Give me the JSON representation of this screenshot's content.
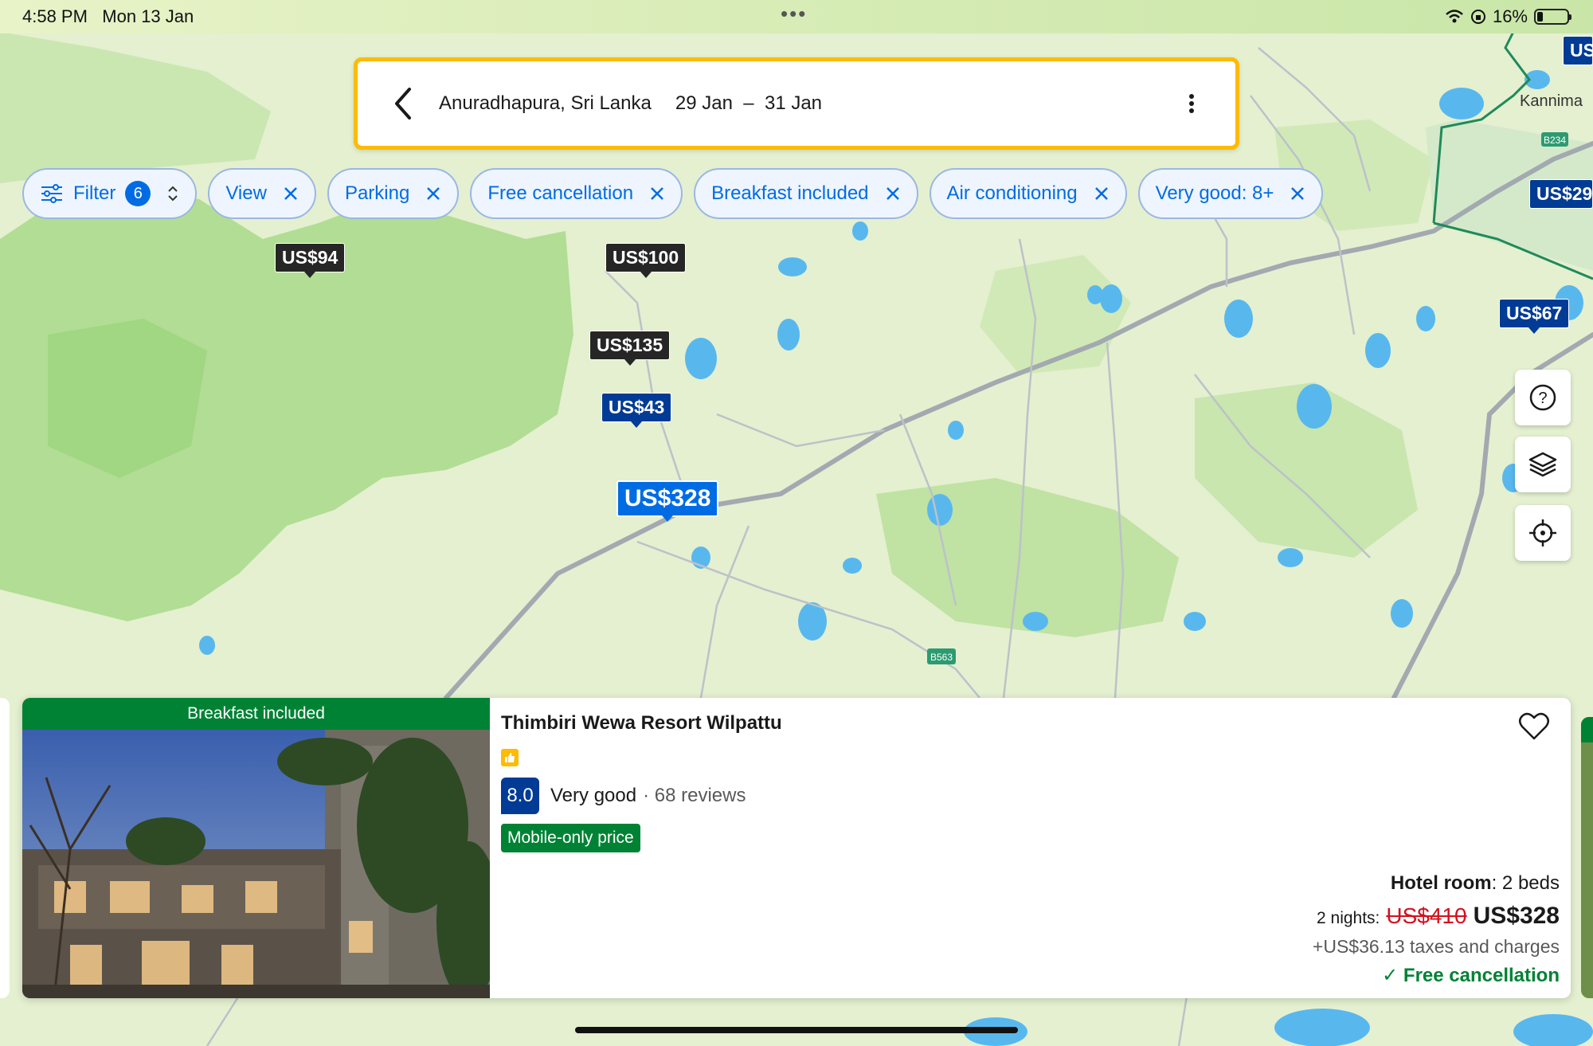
{
  "status_bar": {
    "time": "4:58 PM",
    "date": "Mon 13 Jan",
    "battery": "16%"
  },
  "search": {
    "location": "Anuradhapura, Sri Lanka",
    "check_in": "29 Jan",
    "separator": "–",
    "check_out": "31 Jan"
  },
  "filters": {
    "filter_label": "Filter",
    "filter_count": "6",
    "chips": [
      {
        "label": "View"
      },
      {
        "label": "Parking"
      },
      {
        "label": "Free cancellation"
      },
      {
        "label": "Breakfast included"
      },
      {
        "label": "Air conditioning"
      },
      {
        "label": "Very good: 8+"
      }
    ]
  },
  "map": {
    "place_label": "Kannima",
    "road_labels": [
      "B234",
      "B563"
    ],
    "price_markers": [
      {
        "price": "US$94",
        "style": "dark"
      },
      {
        "price": "US$100",
        "style": "dark"
      },
      {
        "price": "US$135",
        "style": "dark"
      },
      {
        "price": "US$43",
        "style": "blue"
      },
      {
        "price": "US$328",
        "style": "selected"
      },
      {
        "price": "US$67",
        "style": "blue"
      },
      {
        "price": "US$29",
        "style": "blue"
      },
      {
        "price": "US",
        "style": "blue"
      }
    ],
    "controls": [
      "help-icon",
      "layers-icon",
      "locate-icon"
    ]
  },
  "property": {
    "ribbon": "Breakfast included",
    "name": "Thimbiri Wewa Resort Wilpattu",
    "score": "8.0",
    "rating_word": "Very good",
    "reviews": "· 68 reviews",
    "badge": "Mobile-only price",
    "room_type": "Hotel room",
    "room_detail": ": 2 beds",
    "nights": "2 nights:",
    "old_price": "US$410",
    "price": "US$328",
    "taxes": "+US$36.13 taxes and charges",
    "free_cancellation": "✓ Free cancellation"
  },
  "colors": {
    "brand_blue": "#003b95",
    "action_blue": "#006ce4",
    "accent_yellow": "#febb02",
    "green": "#008234",
    "red": "#d4111e"
  }
}
